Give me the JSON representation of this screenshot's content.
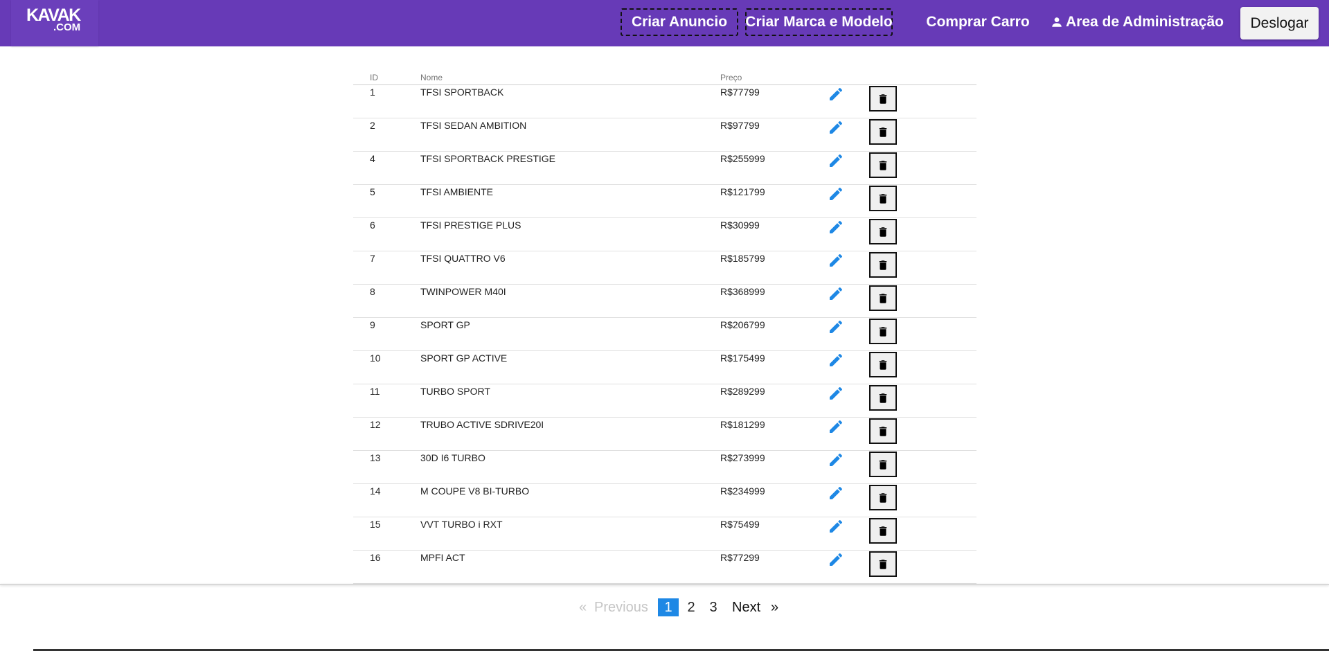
{
  "brand": {
    "logo_main": "KAVAK",
    "logo_sub": ".COM"
  },
  "nav": {
    "criar_anuncio": "Criar Anuncio",
    "criar_marca": "Criar Marca e Modelo",
    "comprar_carro": "Comprar Carro",
    "area_admin": "Area de Administração",
    "logout": "Deslogar"
  },
  "table": {
    "headers": {
      "id": "ID",
      "nome": "Nome",
      "preco": "Preço"
    },
    "rows": [
      {
        "id": "1",
        "nome": "TFSI SPORTBACK",
        "preco": "R$77799"
      },
      {
        "id": "2",
        "nome": "TFSI SEDAN AMBITION",
        "preco": "R$97799"
      },
      {
        "id": "4",
        "nome": "TFSI SPORTBACK PRESTIGE",
        "preco": "R$255999"
      },
      {
        "id": "5",
        "nome": "TFSI AMBIENTE",
        "preco": "R$121799"
      },
      {
        "id": "6",
        "nome": "TFSI PRESTIGE PLUS",
        "preco": "R$30999"
      },
      {
        "id": "7",
        "nome": "TFSI QUATTRO V6",
        "preco": "R$185799"
      },
      {
        "id": "8",
        "nome": "TWINPOWER M40I",
        "preco": "R$368999"
      },
      {
        "id": "9",
        "nome": "SPORT GP",
        "preco": "R$206799"
      },
      {
        "id": "10",
        "nome": "SPORT GP ACTIVE",
        "preco": "R$175499"
      },
      {
        "id": "11",
        "nome": "TURBO SPORT",
        "preco": "R$289299"
      },
      {
        "id": "12",
        "nome": "TRUBO ACTIVE SDRIVE20I",
        "preco": "R$181299"
      },
      {
        "id": "13",
        "nome": "30D I6 TURBO",
        "preco": "R$273999"
      },
      {
        "id": "14",
        "nome": "M COUPE V8 BI-TURBO",
        "preco": "R$234999"
      },
      {
        "id": "15",
        "nome": "VVT TURBO i RXT",
        "preco": "R$75499"
      },
      {
        "id": "16",
        "nome": "MPFI ACT",
        "preco": "R$77299"
      }
    ],
    "edit_icon": "pencil-icon",
    "delete_icon": "trash-icon"
  },
  "pagination": {
    "prev_arrow": "«",
    "prev_label": "Previous",
    "pages": [
      "1",
      "2",
      "3"
    ],
    "current_page": "1",
    "next_label": "Next",
    "next_arrow": "»"
  },
  "colors": {
    "navbar": "#673ab7",
    "edit_icon": "#1e88e5",
    "active_page": "#1e88e5"
  }
}
